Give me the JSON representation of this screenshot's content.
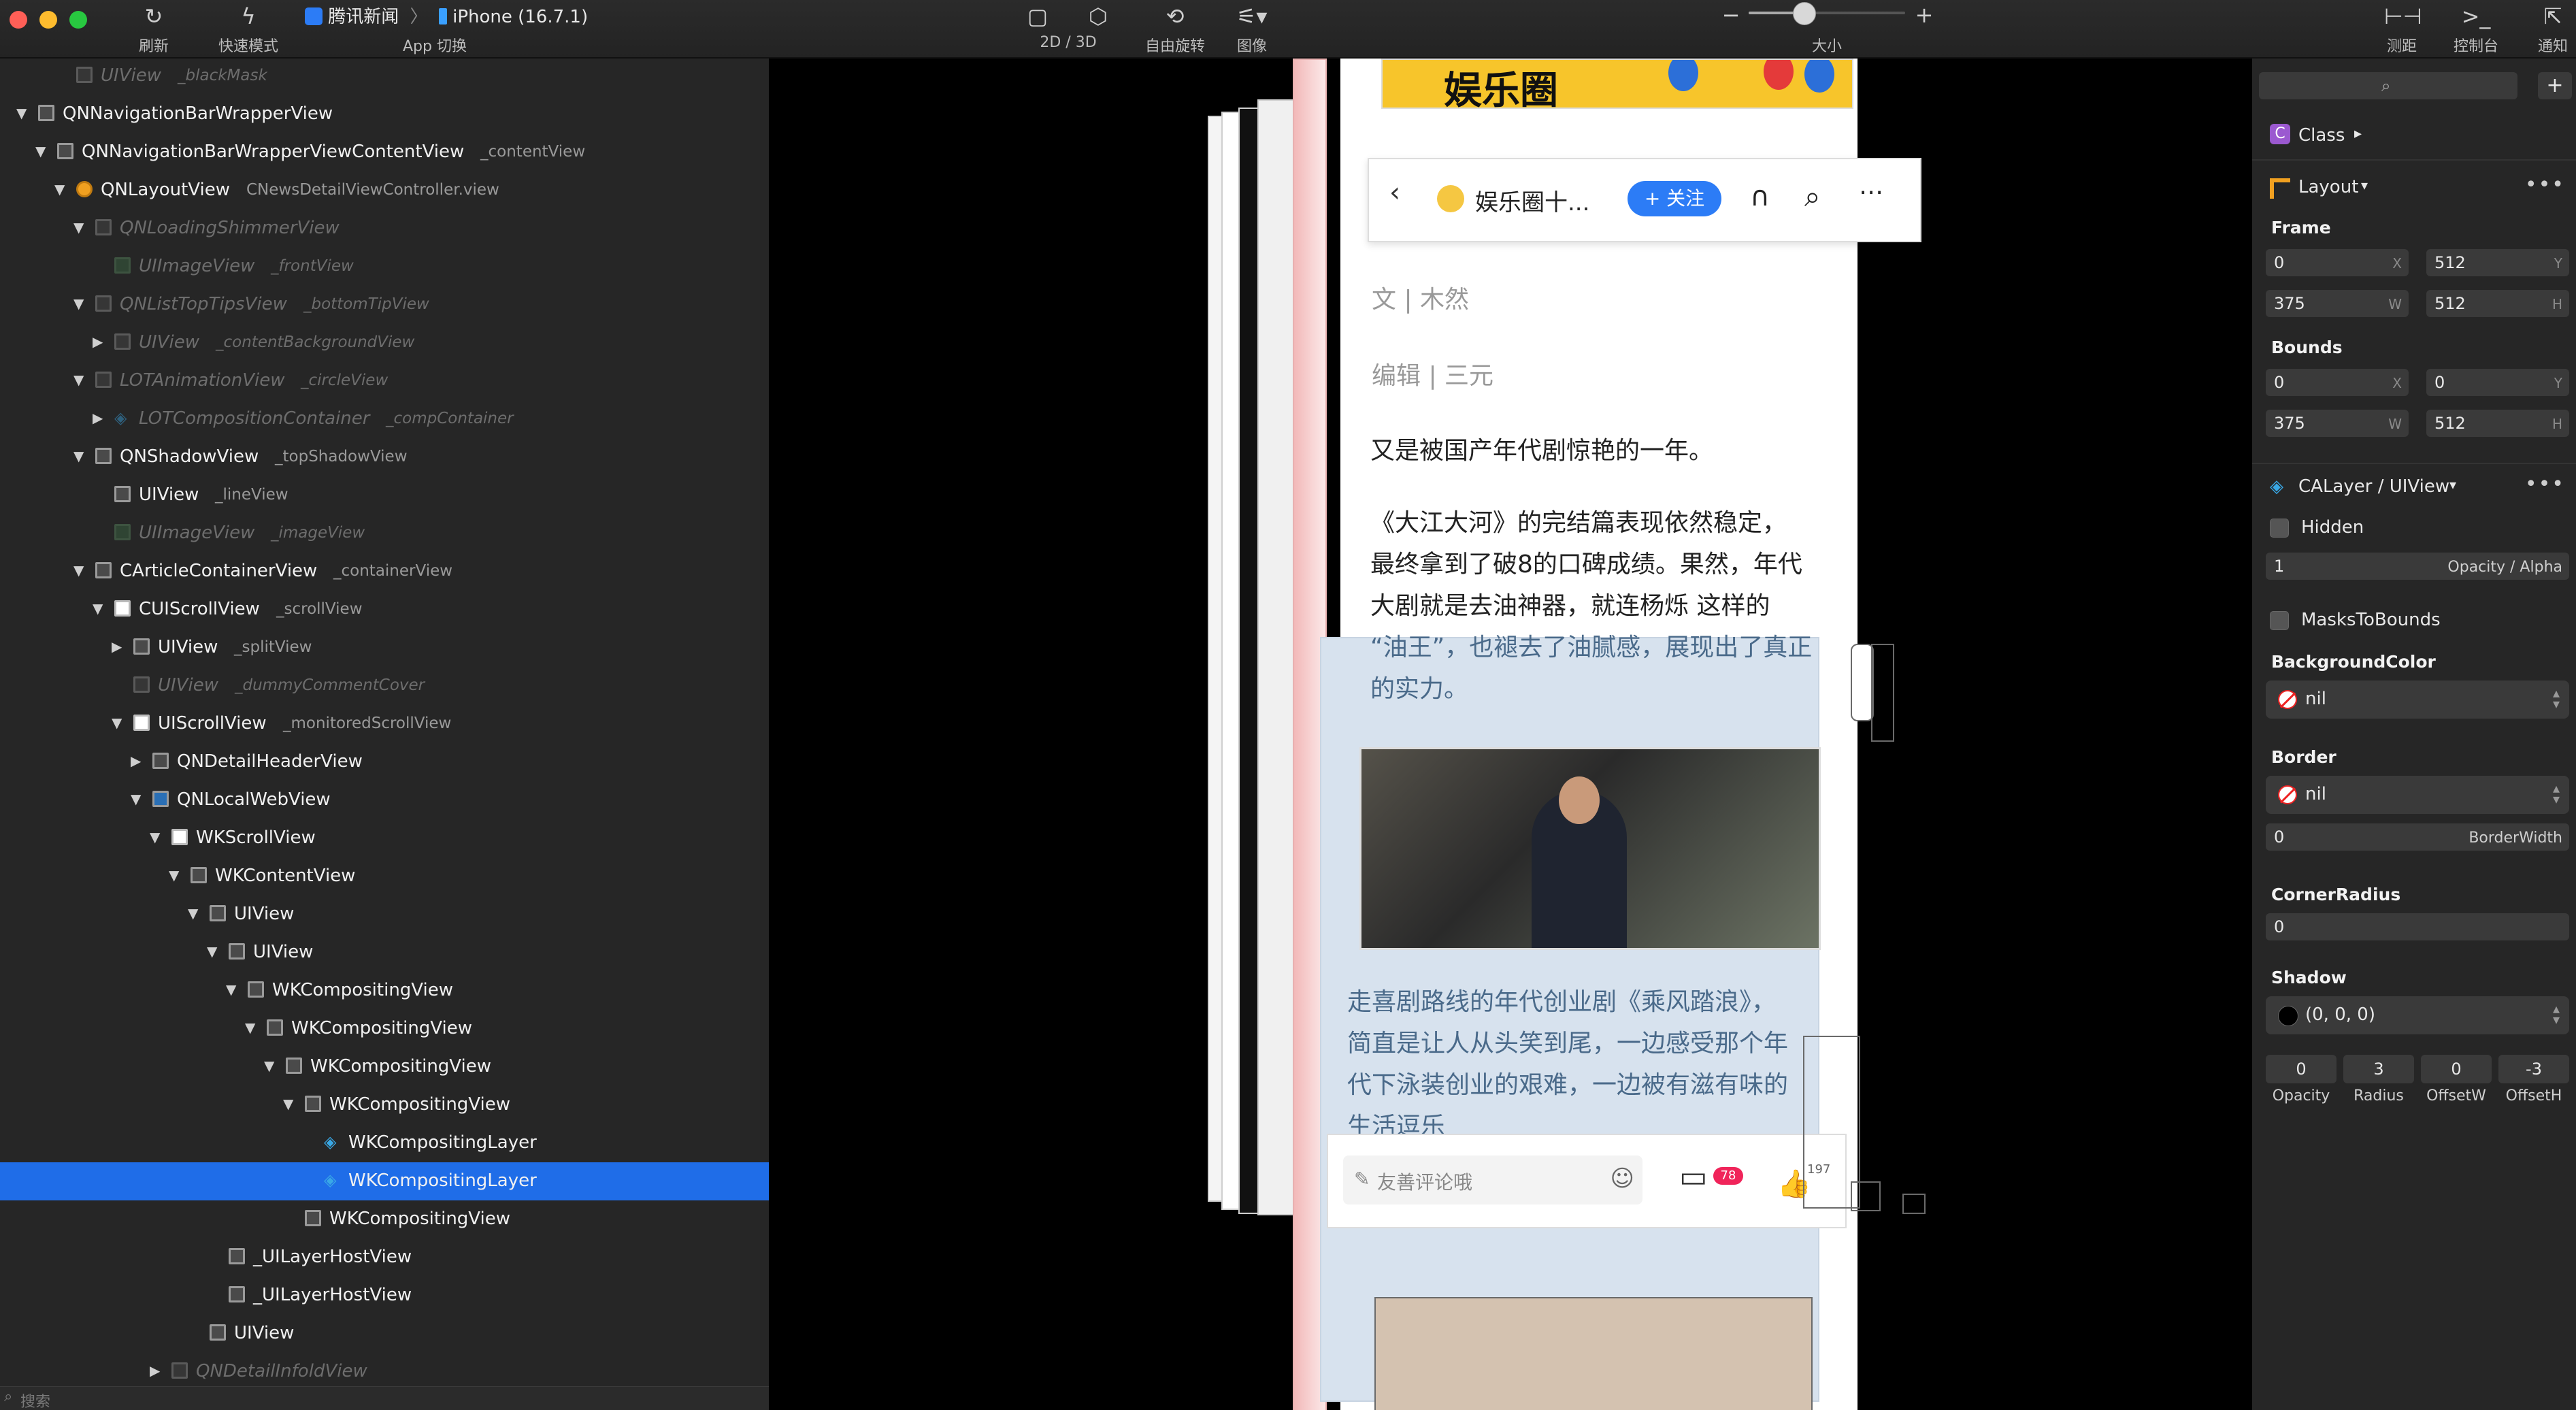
{
  "toolbar": {
    "refresh": "刷新",
    "quick_mode": "快速模式",
    "app_name": "腾讯新闻",
    "device": "iPhone (16.7.1)",
    "app_switch": "App 切换",
    "mode_2d3d": "2D / 3D",
    "free_rotate": "自由旋转",
    "image": "图像",
    "size": "大小",
    "measure": "测距",
    "console": "控制台",
    "notify": "通知",
    "zoom_level": 0.35
  },
  "hierarchy": {
    "rows": [
      {
        "name": "UIView",
        "sub": "_blackMask",
        "dim": true
      },
      {
        "name": "QNNavigationBarWrapperView",
        "sub": ""
      },
      {
        "name": "QNNavigationBarWrapperViewContentView",
        "sub": "_contentView"
      },
      {
        "name": "QNLayoutView",
        "sub": "CNewsDetailViewController.view"
      },
      {
        "name": "QNLoadingShimmerView",
        "sub": "",
        "dim": true
      },
      {
        "name": "UIImageView",
        "sub": "_frontView",
        "dim": true
      },
      {
        "name": "QNListTopTipsView",
        "sub": "_bottomTipView",
        "dim": true
      },
      {
        "name": "UIView",
        "sub": "_contentBackgroundView",
        "dim": true
      },
      {
        "name": "LOTAnimationView",
        "sub": "_circleView",
        "dim": true
      },
      {
        "name": "LOTCompositionContainer",
        "sub": "_compContainer",
        "dim": true
      },
      {
        "name": "QNShadowView",
        "sub": "_topShadowView"
      },
      {
        "name": "UIView",
        "sub": "_lineView"
      },
      {
        "name": "UIImageView",
        "sub": "_imageView",
        "dim": true
      },
      {
        "name": "CArticleContainerView",
        "sub": "_containerView"
      },
      {
        "name": "CUIScrollView",
        "sub": "_scrollView"
      },
      {
        "name": "UIView",
        "sub": "_splitView"
      },
      {
        "name": "UIView",
        "sub": "_dummyCommentCover",
        "dim": true
      },
      {
        "name": "UIScrollView",
        "sub": "_monitoredScrollView"
      },
      {
        "name": "QNDetailHeaderView",
        "sub": ""
      },
      {
        "name": "QNLocalWebView",
        "sub": ""
      },
      {
        "name": "WKScrollView",
        "sub": ""
      },
      {
        "name": "WKContentView",
        "sub": ""
      },
      {
        "name": "UIView",
        "sub": ""
      },
      {
        "name": "UIView",
        "sub": ""
      },
      {
        "name": "WKCompositingView",
        "sub": ""
      },
      {
        "name": "WKCompositingView",
        "sub": ""
      },
      {
        "name": "WKCompositingView",
        "sub": ""
      },
      {
        "name": "WKCompositingView",
        "sub": ""
      },
      {
        "name": "WKCompositingLayer",
        "sub": ""
      },
      {
        "name": "WKCompositingLayer",
        "sub": ""
      },
      {
        "name": "WKCompositingView",
        "sub": ""
      },
      {
        "name": "_UILayerHostView",
        "sub": ""
      },
      {
        "name": "_UILayerHostView",
        "sub": ""
      },
      {
        "name": "UIView",
        "sub": ""
      },
      {
        "name": "QNDetailInfoldView",
        "sub": "",
        "dim": true
      }
    ],
    "search_placeholder": "搜索"
  },
  "article": {
    "banner_text": "娱乐圈",
    "channel_name": "娱乐圈十...",
    "follow_label": "+ 关注",
    "author": "文 | 木然",
    "editor": "编辑 | 三元",
    "para1": "又是被国产年代剧惊艳的一年。",
    "para2_lines": [
      "《大江大河》的完结篇表现依然稳定，",
      "最终拿到了破8的口碑成绩。果然，年代",
      "大剧就是去油神器，就连杨烁 这样的",
      "“油王”，也褪去了油腻感，展现出了真正",
      "的实力。"
    ],
    "para3_lines": [
      "走喜剧路线的年代创业剧《乘风踏浪》，",
      "简直是让人从头笑到尾，一边感受那个年",
      "代下泳装创业的艰难，一边被有滋有味的",
      "生活逗乐"
    ],
    "comment_placeholder": "友善评论哦",
    "comment_count": "78",
    "like_count": "197"
  },
  "inspector": {
    "class_label": "Class",
    "layout_label": "Layout",
    "frame_label": "Frame",
    "frame": {
      "x": "0",
      "y": "512",
      "w": "375",
      "h": "512"
    },
    "bounds_label": "Bounds",
    "bounds": {
      "x": "0",
      "y": "0",
      "w": "375",
      "h": "512"
    },
    "calayer_label": "CALayer / UIView",
    "hidden_label": "Hidden",
    "opacity_value": "1",
    "opacity_label": "Opacity / Alpha",
    "masks_label": "MasksToBounds",
    "bg_color_label": "BackgroundColor",
    "bg_color_value": "nil",
    "border_label": "Border",
    "border_value": "nil",
    "border_width_value": "0",
    "border_width_label": "BorderWidth",
    "corner_label": "CornerRadius",
    "corner_value": "0",
    "shadow_label": "Shadow",
    "shadow_value": "(0, 0, 0)",
    "shadow_fields": [
      {
        "value": "0",
        "label": "Opacity"
      },
      {
        "value": "3",
        "label": "Radius"
      },
      {
        "value": "0",
        "label": "OffsetW"
      },
      {
        "value": "-3",
        "label": "OffsetH"
      }
    ],
    "unit_x": "X",
    "unit_y": "Y",
    "unit_w": "W",
    "unit_h": "H"
  },
  "colors": {
    "selection": "#1f6de8",
    "follow": "#2c7cf6",
    "badge": "#f0245a",
    "banner": "#f7c52b"
  }
}
